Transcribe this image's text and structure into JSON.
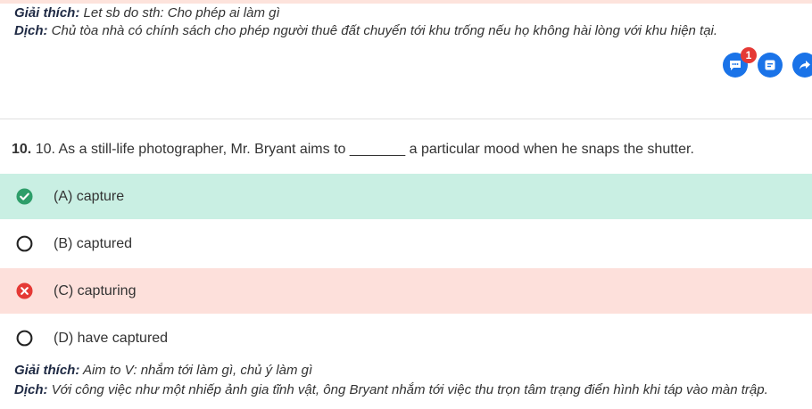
{
  "previous_explanation": {
    "label": "Giải thích:",
    "text": "Let sb do sth: Cho phép ai làm gì",
    "translation_label": "Dịch:",
    "translation": "Chủ tòa nhà có chính sách cho phép người thuê đất chuyển tới khu trống nếu họ không hài lòng với khu hiện tại."
  },
  "actions": {
    "comment_badge_count": "1",
    "icons": [
      "comment-icon",
      "note-icon",
      "share-icon"
    ],
    "accent_color": "#1a73e8",
    "badge_color": "#e53935"
  },
  "question": {
    "number": "10.",
    "text": "10. As a still-life photographer, Mr. Bryant aims to _______ a particular mood when he snaps the shutter."
  },
  "options": [
    {
      "label": "(A) capture",
      "state": "correct"
    },
    {
      "label": "(B) captured",
      "state": "unselected"
    },
    {
      "label": "(C) capturing",
      "state": "wrong"
    },
    {
      "label": "(D) have captured",
      "state": "unselected"
    }
  ],
  "explanation": {
    "label": "Giải thích:",
    "text": "Aim to V: nhắm tới làm gì, chủ ý làm gì",
    "translation_label": "Dịch:",
    "translation": "Với công việc như một nhiếp ảnh gia tĩnh vật, ông Bryant nhắm tới việc thu trọn tâm trạng điển hình khi táp vào màn trập."
  },
  "colors": {
    "correct_bg": "#c9efe3",
    "wrong_bg": "#fde0db",
    "correct_icon": "#2e9e6a",
    "wrong_icon": "#e53935"
  }
}
